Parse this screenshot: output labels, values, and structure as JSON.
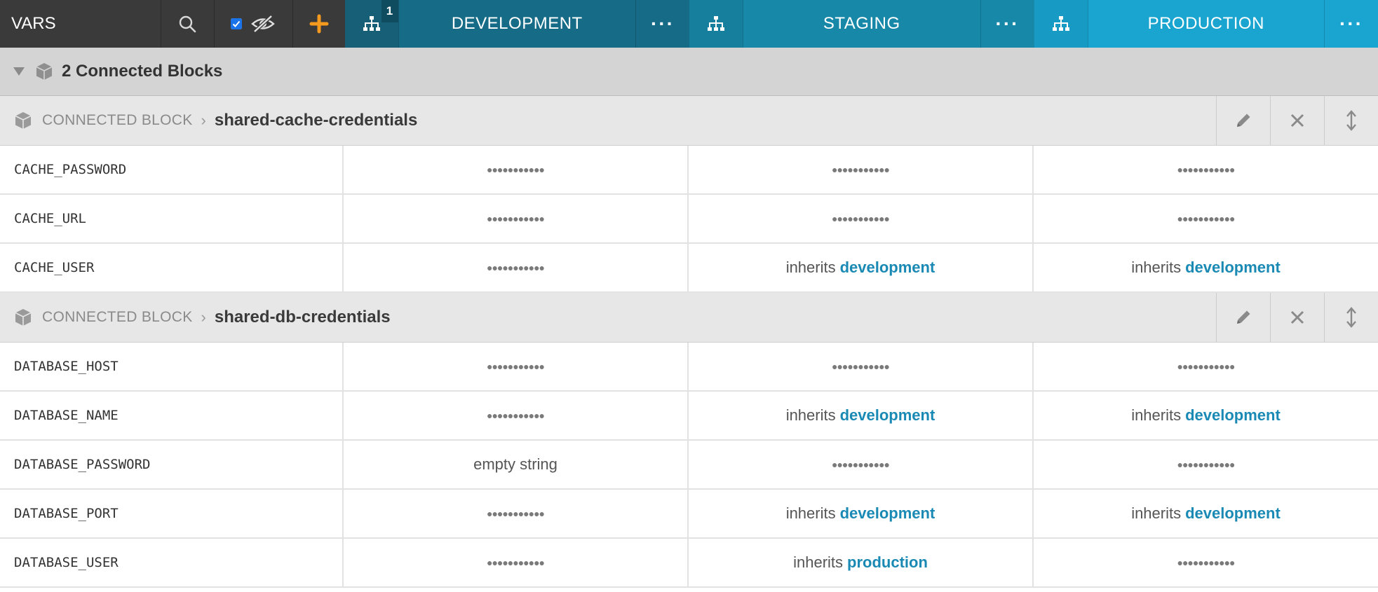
{
  "toolbar": {
    "title": "VARS",
    "search_icon": "search-icon",
    "show_secrets_checked": true,
    "add_icon": "plus-icon"
  },
  "environments": [
    {
      "name": "DEVELOPMENT",
      "badge": "1",
      "more": "···",
      "color": "#166b86"
    },
    {
      "name": "STAGING",
      "badge": "",
      "more": "···",
      "color": "#1888a8"
    },
    {
      "name": "PRODUCTION",
      "badge": "",
      "more": "···",
      "color": "#1aa5d0"
    }
  ],
  "group": {
    "title": "2 Connected Blocks",
    "icon": "cube-icon"
  },
  "blocks": [
    {
      "label": "CONNECTED BLOCK",
      "separator": "›",
      "name": "shared-cache-credentials",
      "rows": [
        {
          "key": "CACHE_PASSWORD",
          "values": [
            {
              "type": "secret",
              "text": "●●●●●●●●●●●"
            },
            {
              "type": "secret",
              "text": "●●●●●●●●●●●"
            },
            {
              "type": "secret",
              "text": "●●●●●●●●●●●"
            }
          ]
        },
        {
          "key": "CACHE_URL",
          "values": [
            {
              "type": "secret",
              "text": "●●●●●●●●●●●"
            },
            {
              "type": "secret",
              "text": "●●●●●●●●●●●"
            },
            {
              "type": "secret",
              "text": "●●●●●●●●●●●"
            }
          ]
        },
        {
          "key": "CACHE_USER",
          "values": [
            {
              "type": "secret",
              "text": "●●●●●●●●●●●"
            },
            {
              "type": "inherits",
              "text": "inherits",
              "target": "development"
            },
            {
              "type": "inherits",
              "text": "inherits",
              "target": "development"
            }
          ]
        }
      ]
    },
    {
      "label": "CONNECTED BLOCK",
      "separator": "›",
      "name": "shared-db-credentials",
      "rows": [
        {
          "key": "DATABASE_HOST",
          "values": [
            {
              "type": "secret",
              "text": "●●●●●●●●●●●"
            },
            {
              "type": "secret",
              "text": "●●●●●●●●●●●"
            },
            {
              "type": "secret",
              "text": "●●●●●●●●●●●"
            }
          ]
        },
        {
          "key": "DATABASE_NAME",
          "values": [
            {
              "type": "secret",
              "text": "●●●●●●●●●●●"
            },
            {
              "type": "inherits",
              "text": "inherits",
              "target": "development"
            },
            {
              "type": "inherits",
              "text": "inherits",
              "target": "development"
            }
          ]
        },
        {
          "key": "DATABASE_PASSWORD",
          "values": [
            {
              "type": "empty",
              "text": "empty string"
            },
            {
              "type": "secret",
              "text": "●●●●●●●●●●●"
            },
            {
              "type": "secret",
              "text": "●●●●●●●●●●●"
            }
          ]
        },
        {
          "key": "DATABASE_PORT",
          "values": [
            {
              "type": "secret",
              "text": "●●●●●●●●●●●"
            },
            {
              "type": "inherits",
              "text": "inherits",
              "target": "development"
            },
            {
              "type": "inherits",
              "text": "inherits",
              "target": "development"
            }
          ]
        },
        {
          "key": "DATABASE_USER",
          "values": [
            {
              "type": "secret",
              "text": "●●●●●●●●●●●"
            },
            {
              "type": "inherits",
              "text": "inherits",
              "target": "production"
            },
            {
              "type": "secret",
              "text": "●●●●●●●●●●●"
            }
          ]
        }
      ]
    }
  ]
}
